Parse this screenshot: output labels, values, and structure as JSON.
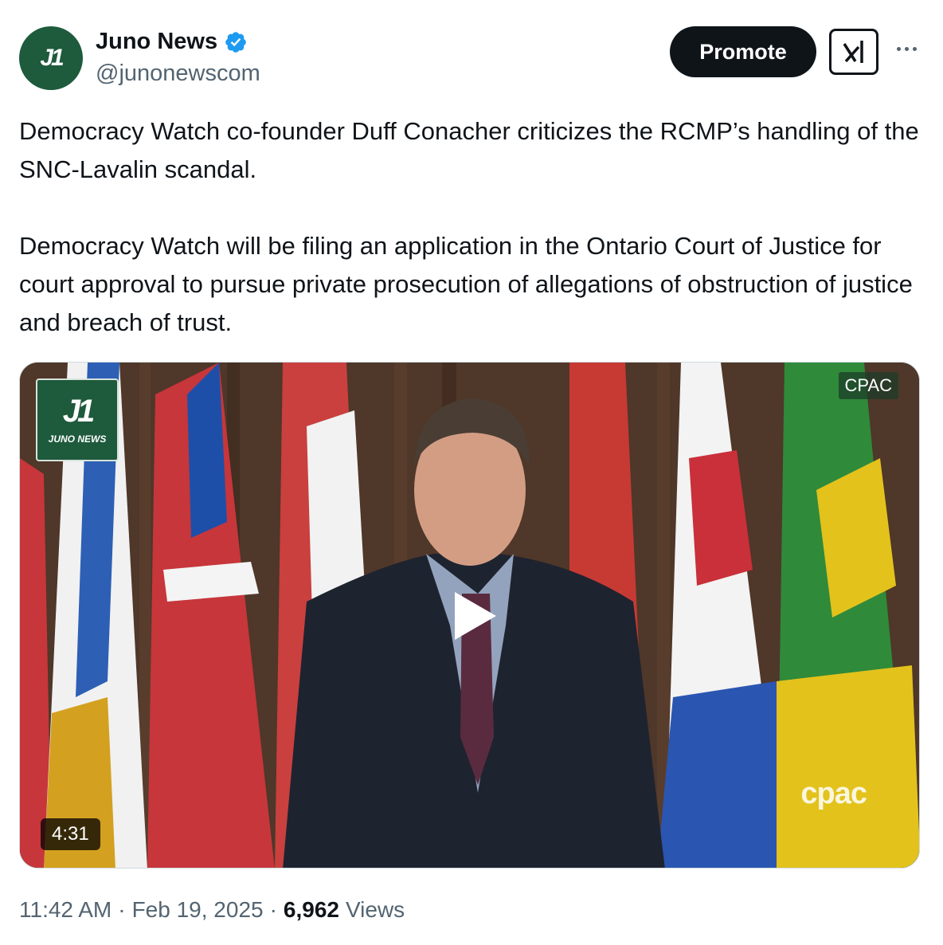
{
  "account": {
    "avatar_text": "J1",
    "display_name": "Juno News",
    "handle": "@junonewscom",
    "verified": true,
    "brand_color": "#1e5a3c"
  },
  "actions": {
    "promote_label": "Promote",
    "grok_icon": "grok-icon",
    "more_icon": "more-icon"
  },
  "tweet": {
    "paragraphs": [
      "Democracy Watch co-founder Duff Conacher criticizes the RCMP’s handling of the SNC-Lavalin scandal.",
      "Democracy Watch will be filing an application in the Ontario Court of Justice for court approval to pursue private prosecution of allegations of obstruction of justice and breach of trust."
    ]
  },
  "video": {
    "badge_logo": "J1",
    "badge_brand": "JUNO NEWS",
    "cpac_tag": "CPAC",
    "cpac_watermark": "cpac",
    "duration": "4:31"
  },
  "meta": {
    "time": "11:42 AM",
    "sep1": "·",
    "date": "Feb 19, 2025",
    "sep2": "·",
    "views_count": "6,962",
    "views_label": "Views"
  }
}
